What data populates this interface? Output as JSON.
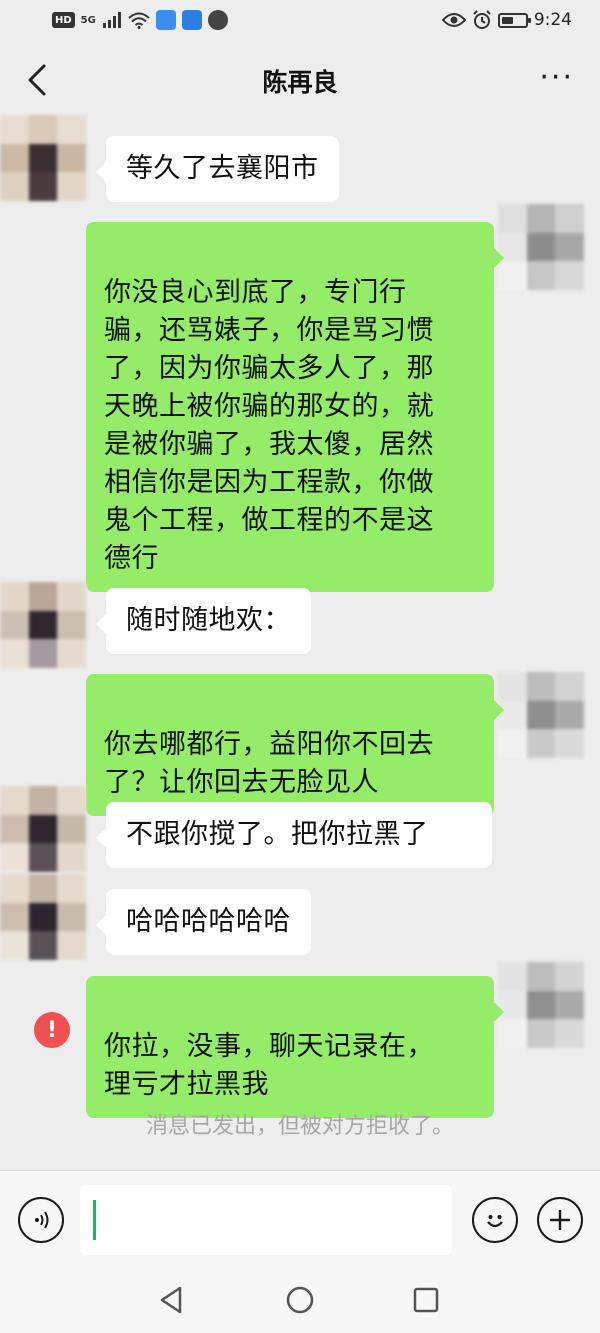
{
  "status_bar": {
    "badge_hd": "HD",
    "network": "5G",
    "time": "9:24",
    "battery_level": 0.45
  },
  "header": {
    "title": "陈再良",
    "more_label": "···"
  },
  "messages": [
    {
      "direction": "in",
      "text": "等久了去襄阳市"
    },
    {
      "direction": "out",
      "text": "你没良心到底了，专门行\n骗，还骂婊子，你是骂习惯\n了，因为你骗太多人了，那\n天晚上被你骗的那女的，就\n是被你骗了，我太傻，居然\n相信你是因为工程款，你做\n鬼个工程，做工程的不是这\n德行"
    },
    {
      "direction": "in",
      "text": "随时随地欢："
    },
    {
      "direction": "out",
      "text": "你去哪都行，益阳你不回去\n了？让你回去无脸见人"
    },
    {
      "direction": "in",
      "text": "不跟你搅了。把你拉黑了"
    },
    {
      "direction": "in",
      "text": "哈哈哈哈哈哈"
    },
    {
      "direction": "out",
      "text": "你拉，没事，聊天记录在，\n理亏才拉黑我",
      "failed": true
    }
  ],
  "error_mark": "!",
  "system_note": "消息已发出，但被对方拒收了。",
  "input": {
    "placeholder": ""
  },
  "colors": {
    "background": "#ededed",
    "out_bubble": "#95ec69",
    "in_bubble": "#ffffff",
    "error": "#f05050",
    "caret": "#07c160"
  },
  "icons": [
    "back-icon",
    "more-icon",
    "voice-icon",
    "emoji-icon",
    "plus-icon",
    "nav-back-icon",
    "nav-home-icon",
    "nav-recents-icon",
    "error-icon"
  ]
}
